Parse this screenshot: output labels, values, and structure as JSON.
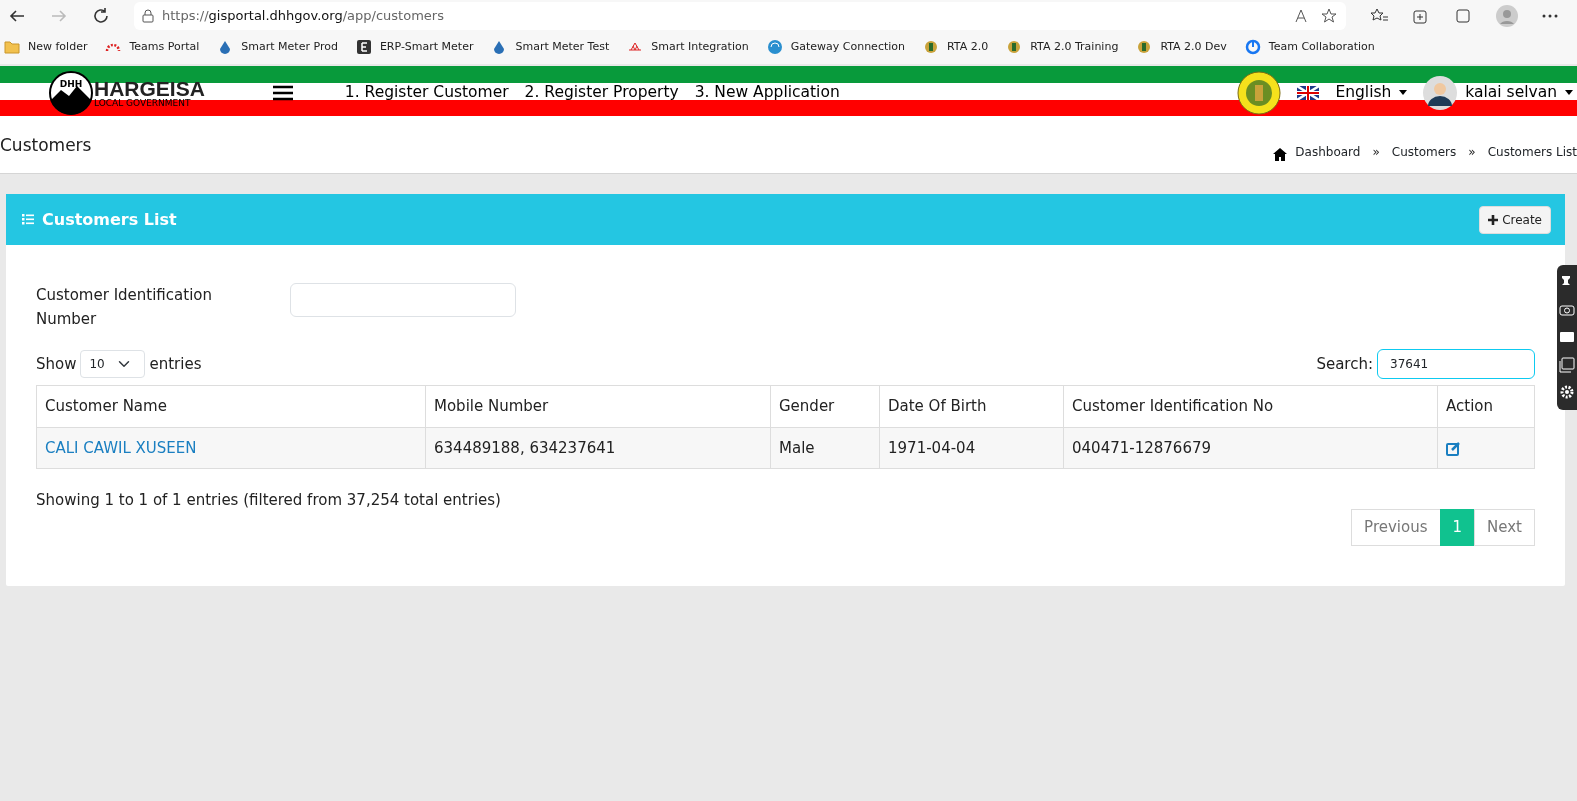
{
  "browser": {
    "url_scheme": "https://",
    "url_host": "gisportal.dhhgov.org",
    "url_path": "/app/customers",
    "bookmarks": [
      {
        "label": "New folder",
        "kind": "folder"
      },
      {
        "label": "Teams Portal",
        "kind": "arc"
      },
      {
        "label": "Smart Meter Prod",
        "kind": "drop"
      },
      {
        "label": "ERP-Smart Meter",
        "kind": "letter"
      },
      {
        "label": "Smart Meter Test",
        "kind": "drop"
      },
      {
        "label": "Smart Integration",
        "kind": "flower"
      },
      {
        "label": "Gateway Connection",
        "kind": "globe"
      },
      {
        "label": "RTA 2.0",
        "kind": "emblem"
      },
      {
        "label": "RTA 2.0 Training",
        "kind": "emblem"
      },
      {
        "label": "RTA 2.0 Dev",
        "kind": "emblem"
      },
      {
        "label": "Team Collaboration",
        "kind": "ring"
      }
    ]
  },
  "header": {
    "logo_letters": "DHH",
    "logo_title": "HARGEISA",
    "logo_subtitle": "LOCAL GOVERNMENT",
    "nav_links": [
      "1. Register Customer",
      "2. Register Property",
      "3. New Application"
    ],
    "language": "English",
    "user": "kalai selvan"
  },
  "page": {
    "title": "Customers",
    "breadcrumbs": [
      "Dashboard",
      "Customers",
      "Customers List"
    ],
    "separator": "»"
  },
  "card": {
    "title": "Customers List",
    "create_button": "Create",
    "filter_label": "Customer Identification Number",
    "show_label": "Show",
    "page_size": "10",
    "entries_label": "entries",
    "search_label": "Search:",
    "search_value": "37641",
    "table": {
      "columns": [
        "Customer Name",
        "Mobile Number",
        "Gender",
        "Date Of Birth",
        "Customer Identification No",
        "Action"
      ],
      "rows": [
        {
          "name": "CALI CAWIL XUSEEN",
          "mobile": "634489188, 634237641",
          "gender": "Male",
          "dob": "1971-04-04",
          "id_no": "040471-12876679"
        }
      ]
    },
    "info": "Showing 1 to 1 of 1 entries (filtered from 37,254 total entries)",
    "pagination": [
      {
        "label": "Previous",
        "selected": false
      },
      {
        "label": "1",
        "selected": true
      },
      {
        "label": "Next",
        "selected": false
      }
    ]
  }
}
